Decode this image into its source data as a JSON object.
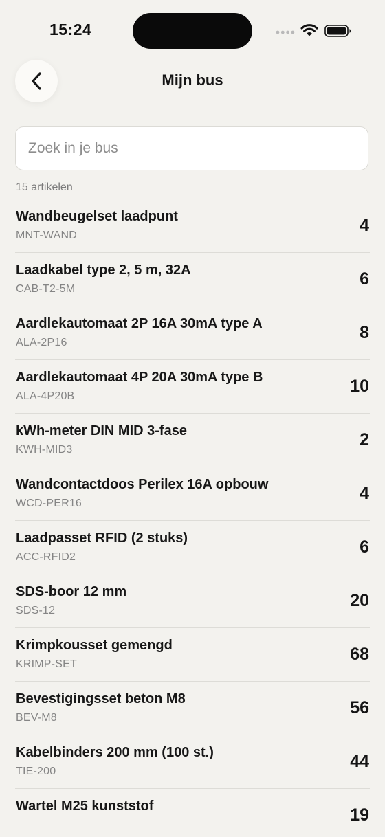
{
  "status_bar": {
    "time": "15:24"
  },
  "nav": {
    "back_icon": "chevron-left-icon",
    "title": "Mijn bus"
  },
  "search": {
    "placeholder": "Zoek in je bus",
    "value": ""
  },
  "list": {
    "count_label": "15 artikelen",
    "items": [
      {
        "name": "Wandbeugelset laadpunt",
        "sku": "MNT-WAND",
        "qty": "4"
      },
      {
        "name": "Laadkabel type 2, 5 m, 32A",
        "sku": "CAB-T2-5M",
        "qty": "6"
      },
      {
        "name": "Aardlekautomaat 2P 16A 30mA type A",
        "sku": "ALA-2P16",
        "qty": "8"
      },
      {
        "name": "Aardlekautomaat 4P 20A 30mA type B",
        "sku": "ALA-4P20B",
        "qty": "10"
      },
      {
        "name": "kWh-meter DIN MID 3-fase",
        "sku": "KWH-MID3",
        "qty": "2"
      },
      {
        "name": "Wandcontactdoos Perilex 16A opbouw",
        "sku": "WCD-PER16",
        "qty": "4"
      },
      {
        "name": "Laadpasset RFID (2 stuks)",
        "sku": "ACC-RFID2",
        "qty": "6"
      },
      {
        "name": "SDS-boor 12 mm",
        "sku": "SDS-12",
        "qty": "20"
      },
      {
        "name": "Krimpkousset gemengd",
        "sku": "KRIMP-SET",
        "qty": "68"
      },
      {
        "name": "Bevestigingsset beton M8",
        "sku": "BEV-M8",
        "qty": "56"
      },
      {
        "name": "Kabelbinders 200 mm (100 st.)",
        "sku": "TIE-200",
        "qty": "44"
      },
      {
        "name": "Wartel M25 kunststof",
        "sku": "",
        "qty": "19"
      }
    ]
  }
}
